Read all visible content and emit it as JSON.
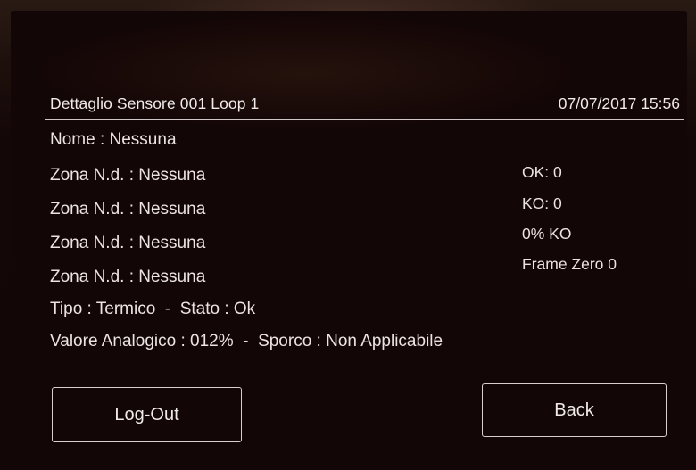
{
  "header": {
    "title": "Dettaglio Sensore 001 Loop 1",
    "datetime": "07/07/2017 15:56"
  },
  "details": {
    "nome": "Nome : Nessuna",
    "zone": [
      "Zona N.d. : Nessuna",
      "Zona N.d. : Nessuna",
      "Zona N.d. : Nessuna",
      "Zona N.d. : Nessuna"
    ],
    "tipo_stato": "Tipo : Termico  -  Stato : Ok",
    "valore_sporco": "Valore Analogico : 012%  -  Sporco : Non Applicabile"
  },
  "stats": {
    "ok": "OK: 0",
    "ko": "KO: 0",
    "ko_percent": "0% KO",
    "frame_zero": "Frame Zero 0"
  },
  "buttons": {
    "logout": "Log-Out",
    "back": "Back"
  }
}
